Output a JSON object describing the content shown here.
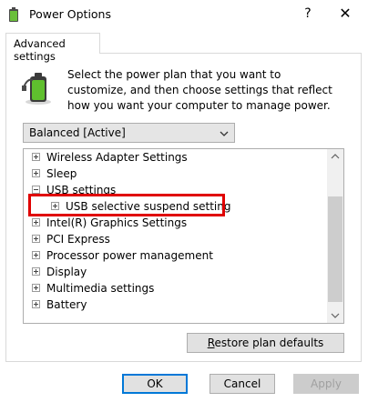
{
  "window": {
    "title": "Power Options",
    "help_label": "?",
    "close_label": "✕",
    "app_icon": "power-options-icon"
  },
  "tabs": [
    {
      "label": "Advanced settings"
    }
  ],
  "description": "Select the power plan that you want to customize, and then choose settings that reflect how you want your computer to manage power.",
  "plan_select": {
    "value": "Balanced [Active]"
  },
  "tree": {
    "items": [
      {
        "label": "Wireless Adapter Settings",
        "expander": "plus"
      },
      {
        "label": "Sleep",
        "expander": "plus"
      },
      {
        "label": "USB settings",
        "expander": "minus"
      },
      {
        "label": "USB selective suspend setting",
        "expander": "plus"
      },
      {
        "label": "Intel(R) Graphics Settings",
        "expander": "plus"
      },
      {
        "label": "PCI Express",
        "expander": "plus"
      },
      {
        "label": "Processor power management",
        "expander": "plus"
      },
      {
        "label": "Display",
        "expander": "plus"
      },
      {
        "label": "Multimedia settings",
        "expander": "plus"
      },
      {
        "label": "Battery",
        "expander": "plus"
      }
    ]
  },
  "buttons": {
    "restore_prefix": "R",
    "restore_rest": "estore plan defaults",
    "ok": "OK",
    "cancel": "Cancel",
    "apply": "Apply"
  },
  "colors": {
    "highlight": "#e00000",
    "accent": "#0078d7"
  }
}
